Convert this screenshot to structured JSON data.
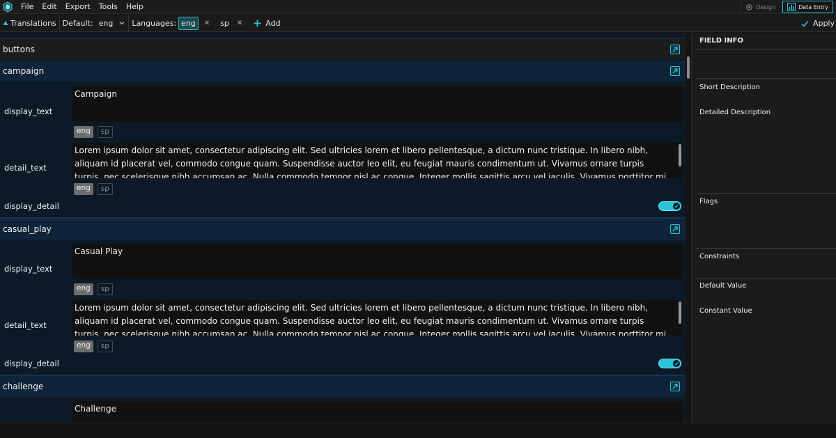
{
  "menubar": {
    "items": [
      "File",
      "Edit",
      "Export",
      "Tools",
      "Help"
    ],
    "modes": {
      "design": "Design",
      "data_entry": "Data Entry"
    }
  },
  "toolbar": {
    "translations": "Translations",
    "default_label": "Default:",
    "default_value": "eng",
    "languages_label": "Languages:",
    "languages": [
      "eng",
      "sp"
    ],
    "add_label": "Add",
    "apply_label": "Apply"
  },
  "main": {
    "sections": [
      {
        "name": "buttons"
      },
      {
        "name": "campaign",
        "display_text_label": "display_text",
        "display_text": "Campaign",
        "detail_text_label": "detail_text",
        "detail_text": "Lorem ipsum dolor sit amet, consectetur adipiscing elit. Sed ultricies lorem et libero pellentesque, a dictum nunc tristique. In libero nibh, aliquam id placerat vel, commodo congue quam. Suspendisse auctor leo elit, eu feugiat mauris condimentum ut. Vivamus ornare turpis turpis, nec scelerisque nibh accumsan ac. Nulla commodo tempor nisl ac congue. Integer mollis sagittis arcu vel iaculis. Vivamus porttitor mi diam, vitae ultricies ante pharetra sit amet.",
        "display_detail_label": "display_detail",
        "display_detail": true,
        "tags": [
          "eng",
          "sp"
        ]
      },
      {
        "name": "casual_play",
        "display_text_label": "display_text",
        "display_text": "Casual Play",
        "detail_text_label": "detail_text",
        "detail_text": "Lorem ipsum dolor sit amet, consectetur adipiscing elit. Sed ultricies lorem et libero pellentesque, a dictum nunc tristique. In libero nibh, aliquam id placerat vel, commodo congue quam. Suspendisse auctor leo elit, eu feugiat mauris condimentum ut. Vivamus ornare turpis turpis, nec scelerisque nibh accumsan ac. Nulla commodo tempor nisl ac congue. Integer mollis sagittis arcu vel iaculis. Vivamus porttitor mi diam, vitae ultricies ante pharetra sit amet.",
        "display_detail_label": "display_detail",
        "display_detail": true,
        "tags": [
          "eng",
          "sp"
        ]
      },
      {
        "name": "challenge",
        "display_text": "Challenge"
      }
    ]
  },
  "field_info": {
    "title": "FIELD INFO",
    "short_description": "Short Description",
    "detailed_description": "Detailed Description",
    "flags": "Flags",
    "constraints": "Constraints",
    "default_value": "Default Value",
    "constant_value": "Constant Value"
  },
  "colors": {
    "accent": "#2bc3d8",
    "panel_blue": "#0c1a28",
    "header_blue": "#0f2438",
    "text_box": "#111111"
  }
}
